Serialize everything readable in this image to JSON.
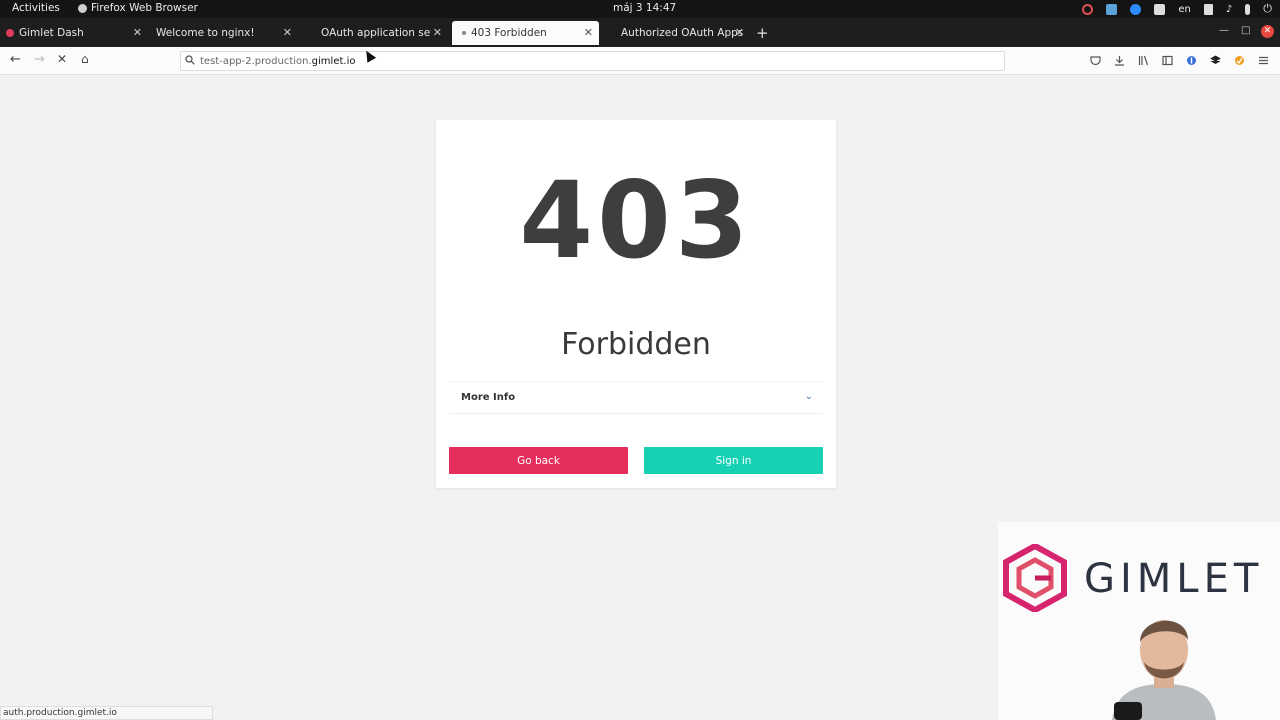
{
  "topbar": {
    "activities": "Activities",
    "app_name": "Firefox Web Browser",
    "clock": "máj 3  14:47",
    "language": "en"
  },
  "tabs": [
    {
      "label": "Gimlet Dash",
      "active": false
    },
    {
      "label": "Welcome to nginx!",
      "active": false
    },
    {
      "label": "OAuth application settin",
      "active": false
    },
    {
      "label": "403 Forbidden",
      "active": true
    },
    {
      "label": "Authorized OAuth Apps",
      "active": false
    }
  ],
  "navbar": {
    "url_prefix": "test-app-2.production.",
    "url_domain": "gimlet.io"
  },
  "page": {
    "code": "403",
    "title": "Forbidden",
    "more_info": "More Info",
    "go_back": "Go back",
    "sign_in": "Sign in"
  },
  "statusbar": {
    "text": "auth.production.gimlet.io"
  },
  "overlay": {
    "brand": "GIMLET"
  },
  "colors": {
    "go_back": "#e62e5c",
    "sign_in": "#17d1b5",
    "logo_magenta": "#d6246e"
  }
}
